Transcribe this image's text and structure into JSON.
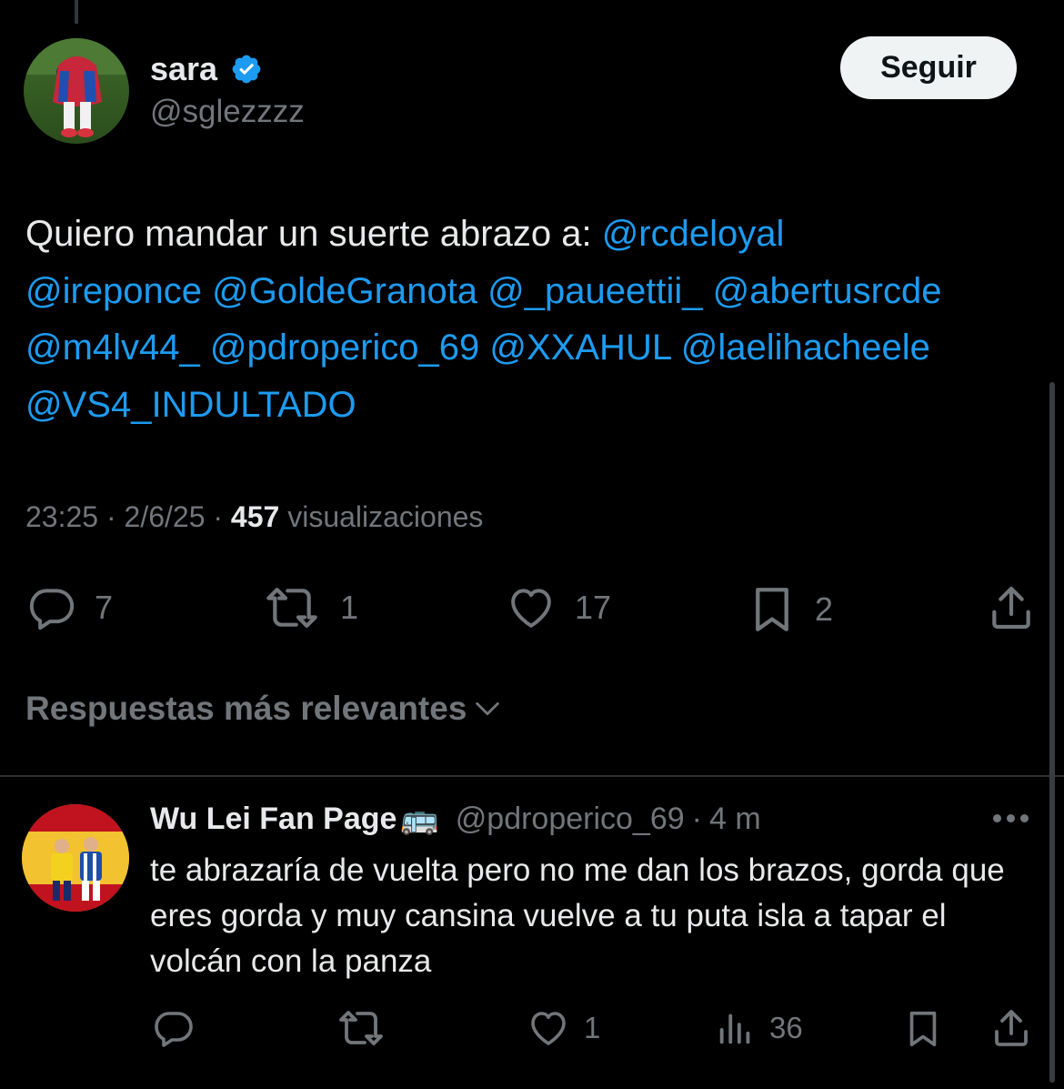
{
  "tweet": {
    "author_name": "sara",
    "author_handle": "@sglezzzz",
    "follow_label": "Seguir",
    "text_intro": "Quiero mandar un suerte abrazo a: ",
    "mentions": [
      "@rcdeloyal",
      "@ireponce",
      "@GoldeGranota",
      "@_paueettii_",
      "@abertusrcde",
      "@m4lv44_",
      "@pdroperico_69",
      "@XXAHUL",
      "@laelihacheele",
      "@VS4_INDULTADO"
    ],
    "time": "23:25",
    "date": "2/6/25",
    "views_count": "457",
    "views_label": "visualizaciones",
    "replies": "7",
    "retweets": "1",
    "likes": "17",
    "bookmarks": "2"
  },
  "sort": {
    "label": "Respuestas más relevantes"
  },
  "reply": {
    "author_name": "Wu Lei Fan Page",
    "emoji": "🚌",
    "author_handle": "@pdroperico_69",
    "separator": "·",
    "time": "4 m",
    "text": "te abrazaría de vuelta pero no me dan los brazos, gorda que eres gorda y muy cansina vuelve a tu puta isla a tapar el volcán con la panza",
    "likes": "1",
    "views": "36"
  },
  "icons": {
    "verified": "verified-badge-icon",
    "reply": "reply-icon",
    "retweet": "retweet-icon",
    "like": "heart-icon",
    "bookmark": "bookmark-icon",
    "share": "share-icon",
    "views": "views-icon",
    "more": "more-icon",
    "chevron": "chevron-down-icon"
  },
  "colors": {
    "background": "#000000",
    "mention": "#1d9bf0",
    "muted": "#71767b",
    "verified": "#1d9bf0"
  }
}
